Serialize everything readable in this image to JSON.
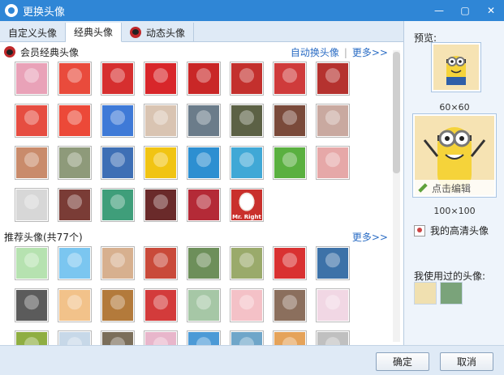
{
  "window": {
    "title": "更换头像",
    "buttons": [
      "minimize-icon",
      "maximize-icon",
      "close-icon"
    ]
  },
  "tabs": [
    {
      "label": "自定义头像",
      "active": false
    },
    {
      "label": "经典头像",
      "active": true
    },
    {
      "label": "动态头像",
      "active": false,
      "icon": "penguin-icon"
    }
  ],
  "section_member": {
    "title": "会员经典头像",
    "auto_change": "自动换头像",
    "more": "更多>>",
    "avatars": [
      "#e9a2b8",
      "#e94b3c",
      "#d62f2f",
      "#d8262a",
      "#c92727",
      "#c3302d",
      "#cf3b3b",
      "#b5322f",
      "#e64d41",
      "#ec4938",
      "#3f7ad7",
      "#d9c4b2",
      "#6b7c8a",
      "#5c6145",
      "#7a4a3a",
      "#c9a9a0",
      "#c98b6b",
      "#8e9a7a",
      "#3e6fb5",
      "#f1c413",
      "#2d8fd1",
      "#40a8d6",
      "#5ab040",
      "#e6a8a8",
      "#d7d7d7",
      "#7a3c36",
      "#3f9e7a",
      "#6a2a2a",
      "#b42a37",
      "#f2e6d9"
    ],
    "last_label": "Mr. Right"
  },
  "section_recommend": {
    "title": "推荐头像(共77个)",
    "more": "更多>>",
    "avatars": [
      "#b6e2b0",
      "#7bc6f0",
      "#d7b08f",
      "#c94a3a",
      "#6d8f5a",
      "#9aaa6b",
      "#d93131",
      "#3d72a8",
      "#5b5b5b",
      "#f2c28a",
      "#b37a3b",
      "#d33b3b",
      "#a6c7a6",
      "#f4c1c7",
      "#8b6f5d",
      "#f1d7e4",
      "#8fae42",
      "#c7d8e8",
      "#7b6e5a",
      "#e8b6cb",
      "#4c9ad6",
      "#6fa6c9",
      "#e5a35a",
      "#c0c0c0"
    ]
  },
  "preview": {
    "label": "预览:",
    "caption_small": "60×60",
    "caption_large": "100×100",
    "edit": "点击编辑"
  },
  "hd_avatar": "我的高清头像",
  "used": {
    "label": "我使用过的头像:",
    "avatars": [
      "#f0e0b0",
      "#7aa37a"
    ]
  },
  "footer": {
    "confirm": "确定",
    "cancel": "取消"
  }
}
